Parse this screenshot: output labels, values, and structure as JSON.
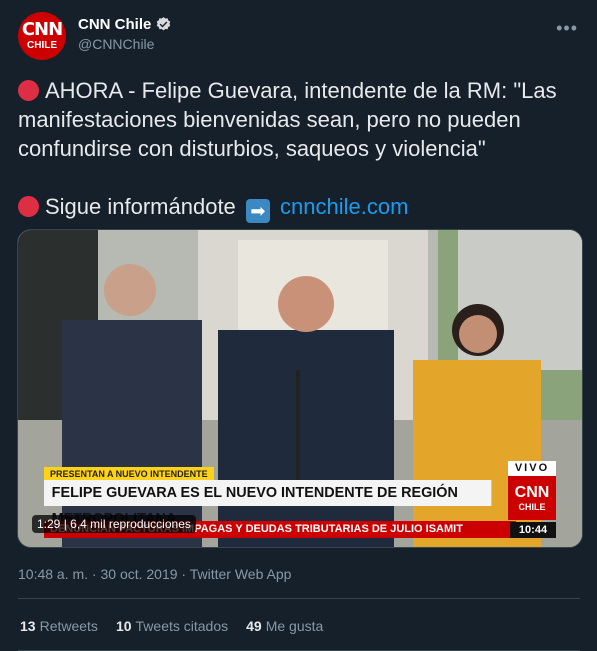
{
  "account": {
    "avatar_text_top": "CNN",
    "avatar_text_bottom": "CHILE",
    "display_name": "CNN Chile",
    "handle": "@CNNChile",
    "more_icon": "ellipsis-icon"
  },
  "tweet": {
    "line1": "AHORA - Felipe Guevara, intendente de la RM: \"Las manifestaciones bienvenidas sean, pero no pueden confundirse con disturbios, saqueos y violencia\"",
    "line2_text": "Sigue informándote",
    "arrow_glyph": "➡",
    "link": "cnnchile.com"
  },
  "video": {
    "tag": "PRESENTAN A NUEVO INTENDENTE",
    "headline": "FELIPE GUEVARA ES EL NUEVO INTENDENTE DE REGIÓN METROPOLITANA",
    "ticker": "DENUNCIAN FACTURAS IMPAGAS Y DEUDAS TRIBUTARIAS DE JULIO ISAMIT",
    "live_label": "VIVO",
    "bug_top": "CNN",
    "bug_bottom": "CHILE",
    "clock": "10:44",
    "views_overlay": "1:29 | 6,4 mil reproducciones"
  },
  "meta": {
    "timestamp": "10:48 a. m. · 30 oct. 2019 · Twitter Web App"
  },
  "stats": {
    "retweets_count": "13",
    "retweets_label": "Retweets",
    "quotes_count": "10",
    "quotes_label": "Tweets citados",
    "likes_count": "49",
    "likes_label": "Me gusta"
  },
  "colors": {
    "background": "#15202b",
    "link": "#1d9bf0",
    "brand_red": "#cc0000",
    "muted": "#8899a6"
  }
}
